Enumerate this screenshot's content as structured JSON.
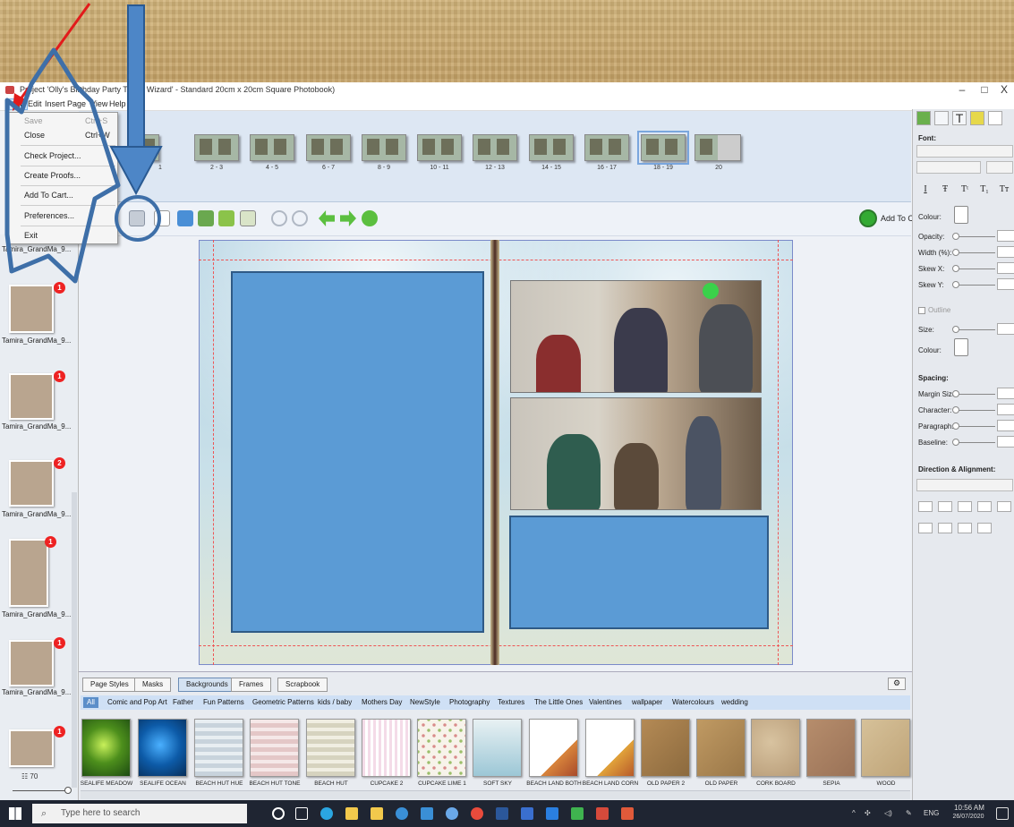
{
  "window": {
    "title": "Project 'Olly's Birthday Party Test 2 Wizard' - Standard 20cm x 20cm Square Photobook)",
    "min_label": "–",
    "max_label": "□",
    "close_label": "X"
  },
  "menubar": {
    "items": [
      "File",
      "Edit",
      "Insert",
      "Page",
      "View",
      "Help"
    ]
  },
  "file_menu": {
    "items": [
      {
        "label": "Save",
        "shortcut": "Ctrl+S",
        "enabled": false
      },
      {
        "label": "Close",
        "shortcut": "Ctrl+W",
        "enabled": true
      },
      {
        "label": "Check Project...",
        "shortcut": "",
        "enabled": true
      },
      {
        "label": "Create Proofs...",
        "shortcut": "",
        "enabled": true
      },
      {
        "label": "Add To Cart...",
        "shortcut": "",
        "enabled": true
      },
      {
        "label": "Preferences...",
        "shortcut": "",
        "enabled": true
      },
      {
        "label": "Exit",
        "shortcut": "",
        "enabled": true
      }
    ]
  },
  "page_strip": {
    "pages": [
      "1",
      "2 - 3",
      "4 - 5",
      "6 - 7",
      "8 - 9",
      "10 - 11",
      "12 - 13",
      "14 - 15",
      "16 - 17",
      "18 - 19",
      "20"
    ],
    "selected": "18 - 19"
  },
  "toolbar": {
    "add_to_cart": "Add To Cart",
    "icons": [
      "save-icon",
      "add-page-icon",
      "add-photo-icon",
      "add-text-icon",
      "rotate-icon",
      "copy-icon",
      "zoom-out-icon",
      "zoom-in-icon",
      "back-arrow-icon",
      "forward-arrow-icon",
      "play-icon"
    ]
  },
  "sidebar": {
    "items": [
      {
        "name": "Tamira_GrandMa_9...",
        "count": ""
      },
      {
        "name": "Tamira_GrandMa_9...",
        "count": "1"
      },
      {
        "name": "Tamira_GrandMa_9...",
        "count": "1"
      },
      {
        "name": "Tamira_GrandMa_9...",
        "count": "2"
      },
      {
        "name": "Tamira_GrandMa_9...",
        "count": "1"
      },
      {
        "name": "Tamira_GrandMa_9...",
        "count": "1"
      },
      {
        "name": "",
        "count": "1"
      }
    ],
    "photo_count": "70"
  },
  "right_panel": {
    "font_label": "Font:",
    "format_buttons": [
      "I",
      "Ŧ",
      "Tᵗ",
      "T₁",
      "Tт"
    ],
    "colour_label": "Colour:",
    "opacity_label": "Opacity:",
    "width_label": "Width (%):",
    "skewx_label": "Skew X:",
    "skewy_label": "Skew Y:",
    "outline_label": "Outline",
    "size_label": "Size:",
    "colour2_label": "Colour:",
    "spacing_label": "Spacing:",
    "margin_label": "Margin Size:",
    "character_label": "Character:",
    "paragraph_label": "Paragraph:",
    "baseline_label": "Baseline:",
    "direction_label": "Direction & Alignment:"
  },
  "bottom_panel": {
    "tabs": [
      "Page Styles",
      "Masks",
      "Backgrounds",
      "Frames",
      "Scrapbook"
    ],
    "active_tab": "Backgrounds",
    "categories": [
      "All",
      "Comic and Pop Art",
      "Father",
      "Fun Patterns",
      "Geometric Patterns",
      "kids / baby",
      "Mothers Day",
      "NewStyle",
      "Photography",
      "Textures",
      "The Little Ones",
      "Valentines",
      "wallpaper",
      "Watercolours",
      "wedding"
    ],
    "backgrounds": [
      "SEALIFE MEADOW",
      "SEALIFE OCEAN",
      "BEACH HUT HUE",
      "BEACH HUT TONE",
      "BEACH HUT",
      "CUPCAKE 2",
      "CUPCAKE LIME 1",
      "SOFT SKY",
      "BEACH LAND BOTH",
      "BEACH LAND CORN",
      "OLD PAPER 2",
      "OLD PAPER",
      "CORK BOARD",
      "SEPIA",
      "WOOD"
    ]
  },
  "taskbar": {
    "search_placeholder": "Type here to search",
    "lang": "ENG",
    "time": "10:56 AM",
    "date": "26/07/2020"
  }
}
